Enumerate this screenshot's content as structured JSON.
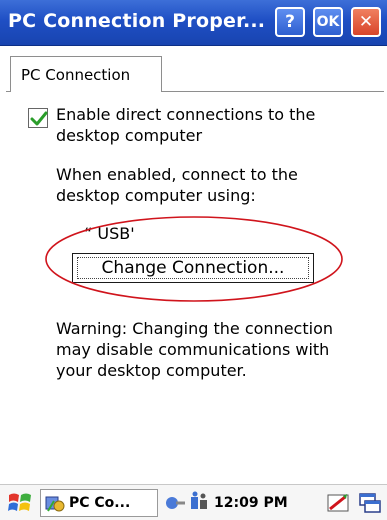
{
  "window": {
    "title": "PC Connection Proper...",
    "help_label": "?",
    "ok_label": "OK",
    "close_label": "✕"
  },
  "tabs": [
    {
      "label": "PC Connection"
    }
  ],
  "content": {
    "checkbox_label": "Enable direct connections to the desktop computer",
    "checkbox_checked": true,
    "info_text": "When enabled, connect to the desktop computer using:",
    "connection_value": "“ USB'",
    "change_button_label": "Change Connection...",
    "warning_text": "Warning: Changing the connection may disable communications with your desktop computer."
  },
  "taskbar": {
    "start_icon": "windows-flag-icon",
    "task_label": "PC Co...",
    "clock": "12:09 PM",
    "icons": [
      "network-icon",
      "sync-icon",
      "keyboard-icon",
      "desktop-icon"
    ]
  },
  "colors": {
    "titlebar": "#1f4fc4",
    "check": "#2a9d2a",
    "annotation_ellipse": "#d0141c"
  }
}
